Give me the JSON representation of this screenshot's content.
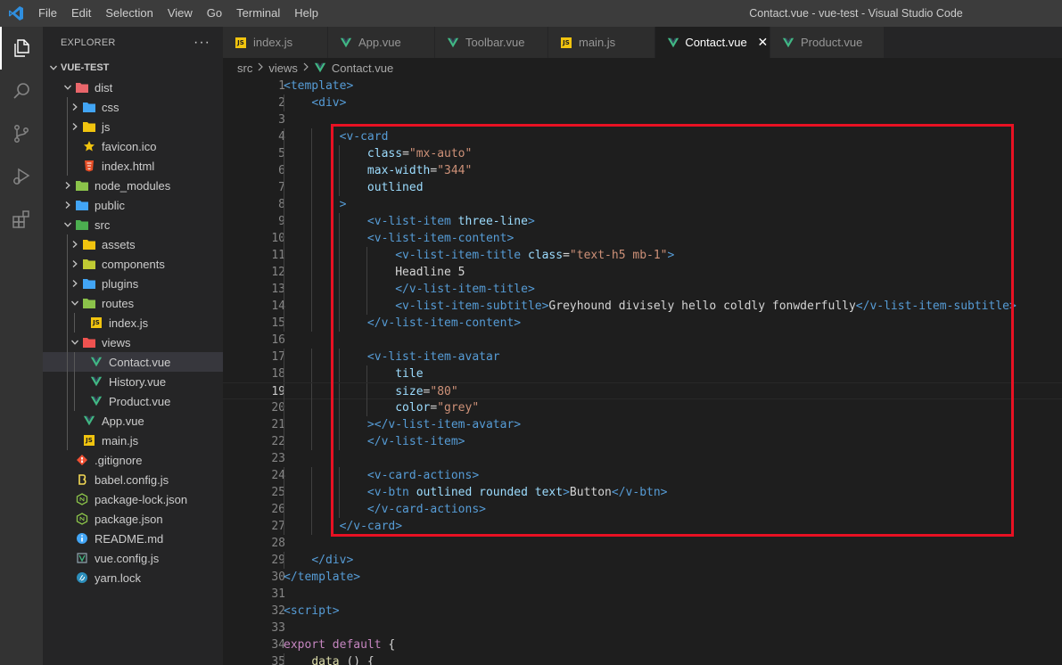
{
  "titlebar": {
    "menu": [
      "File",
      "Edit",
      "Selection",
      "View",
      "Go",
      "Terminal",
      "Help"
    ],
    "title": "Contact.vue - vue-test - Visual Studio Code"
  },
  "activity_bar": [
    "explorer-icon",
    "search-icon",
    "source-control-icon",
    "run-debug-icon",
    "extensions-icon"
  ],
  "explorer": {
    "header": "EXPLORER",
    "more": "···",
    "tree": [
      {
        "label": "VUE-TEST",
        "depth": 0,
        "kind": "root",
        "open": true
      },
      {
        "label": "dist",
        "depth": 1,
        "kind": "folder",
        "open": true,
        "color": "#e8676b"
      },
      {
        "label": "css",
        "depth": 2,
        "kind": "folder",
        "open": false,
        "color": "#42a5f5"
      },
      {
        "label": "js",
        "depth": 2,
        "kind": "folder",
        "open": false,
        "color": "#f1c40f"
      },
      {
        "label": "favicon.ico",
        "depth": 2,
        "kind": "star"
      },
      {
        "label": "index.html",
        "depth": 2,
        "kind": "html"
      },
      {
        "label": "node_modules",
        "depth": 1,
        "kind": "folder",
        "open": false,
        "color": "#8bc34a"
      },
      {
        "label": "public",
        "depth": 1,
        "kind": "folder",
        "open": false,
        "color": "#42a5f5"
      },
      {
        "label": "src",
        "depth": 1,
        "kind": "folder",
        "open": true,
        "color": "#4caf50"
      },
      {
        "label": "assets",
        "depth": 2,
        "kind": "folder",
        "open": false,
        "color": "#f1c40f"
      },
      {
        "label": "components",
        "depth": 2,
        "kind": "folder",
        "open": false,
        "color": "#c0ca33"
      },
      {
        "label": "plugins",
        "depth": 2,
        "kind": "folder",
        "open": false,
        "color": "#42a5f5"
      },
      {
        "label": "routes",
        "depth": 2,
        "kind": "folder",
        "open": true,
        "color": "#8bc34a"
      },
      {
        "label": "index.js",
        "depth": 3,
        "kind": "js"
      },
      {
        "label": "views",
        "depth": 2,
        "kind": "folder",
        "open": true,
        "color": "#ef5350"
      },
      {
        "label": "Contact.vue",
        "depth": 3,
        "kind": "vue",
        "selected": true
      },
      {
        "label": "History.vue",
        "depth": 3,
        "kind": "vue"
      },
      {
        "label": "Product.vue",
        "depth": 3,
        "kind": "vue"
      },
      {
        "label": "App.vue",
        "depth": 2,
        "kind": "vue"
      },
      {
        "label": "main.js",
        "depth": 2,
        "kind": "js"
      },
      {
        "label": ".gitignore",
        "depth": 1,
        "kind": "git"
      },
      {
        "label": "babel.config.js",
        "depth": 1,
        "kind": "babel"
      },
      {
        "label": "package-lock.json",
        "depth": 1,
        "kind": "npm"
      },
      {
        "label": "package.json",
        "depth": 1,
        "kind": "npm"
      },
      {
        "label": "README.md",
        "depth": 1,
        "kind": "info"
      },
      {
        "label": "vue.config.js",
        "depth": 1,
        "kind": "vuecfg"
      },
      {
        "label": "yarn.lock",
        "depth": 1,
        "kind": "yarn"
      }
    ]
  },
  "tabs": [
    {
      "label": "index.js",
      "kind": "js",
      "width": 118
    },
    {
      "label": "App.vue",
      "kind": "vue",
      "width": 120
    },
    {
      "label": "Toolbar.vue",
      "kind": "vue",
      "width": 127
    },
    {
      "label": "main.js",
      "kind": "js",
      "width": 120
    },
    {
      "label": "Contact.vue",
      "kind": "vue",
      "active": true,
      "close": "✕",
      "width": 129
    },
    {
      "label": "Product.vue",
      "kind": "vue",
      "width": 128
    }
  ],
  "breadcrumb": [
    "src",
    "views",
    "Contact.vue"
  ],
  "editor": {
    "current_line": 19,
    "lines": [
      [
        [
          "t-tag",
          "<template>"
        ]
      ],
      [
        [
          "t-pl",
          "    "
        ],
        [
          "t-tag",
          "<div>"
        ]
      ],
      [],
      [
        [
          "t-pl",
          "        "
        ],
        [
          "t-tag",
          "<v-card"
        ]
      ],
      [
        [
          "t-pl",
          "            "
        ],
        [
          "t-attr",
          "class"
        ],
        [
          "t-pl",
          "="
        ],
        [
          "t-str",
          "\"mx-auto\""
        ]
      ],
      [
        [
          "t-pl",
          "            "
        ],
        [
          "t-attr",
          "max-width"
        ],
        [
          "t-pl",
          "="
        ],
        [
          "t-str",
          "\"344\""
        ]
      ],
      [
        [
          "t-pl",
          "            "
        ],
        [
          "t-attr",
          "outlined"
        ]
      ],
      [
        [
          "t-pl",
          "        "
        ],
        [
          "t-tag",
          ">"
        ]
      ],
      [
        [
          "t-pl",
          "            "
        ],
        [
          "t-tag",
          "<v-list-item"
        ],
        [
          "t-pl",
          " "
        ],
        [
          "t-attr",
          "three-line"
        ],
        [
          "t-tag",
          ">"
        ]
      ],
      [
        [
          "t-pl",
          "            "
        ],
        [
          "t-tag",
          "<v-list-item-content>"
        ]
      ],
      [
        [
          "t-pl",
          "                "
        ],
        [
          "t-tag",
          "<v-list-item-title"
        ],
        [
          "t-pl",
          " "
        ],
        [
          "t-attr",
          "class"
        ],
        [
          "t-pl",
          "="
        ],
        [
          "t-str",
          "\"text-h5 mb-1\""
        ],
        [
          "t-tag",
          ">"
        ]
      ],
      [
        [
          "t-pl",
          "                Headline 5"
        ]
      ],
      [
        [
          "t-pl",
          "                "
        ],
        [
          "t-tag",
          "</v-list-item-title>"
        ]
      ],
      [
        [
          "t-pl",
          "                "
        ],
        [
          "t-tag",
          "<v-list-item-subtitle>"
        ],
        [
          "t-pl",
          "Greyhound divisely hello coldly fonwderfully"
        ],
        [
          "t-tag",
          "</v-list-item-subtitle>"
        ]
      ],
      [
        [
          "t-pl",
          "            "
        ],
        [
          "t-tag",
          "</v-list-item-content>"
        ]
      ],
      [],
      [
        [
          "t-pl",
          "            "
        ],
        [
          "t-tag",
          "<v-list-item-avatar"
        ]
      ],
      [
        [
          "t-pl",
          "                "
        ],
        [
          "t-attr",
          "tile"
        ]
      ],
      [
        [
          "t-pl",
          "                "
        ],
        [
          "t-attr",
          "size"
        ],
        [
          "t-pl",
          "="
        ],
        [
          "t-str",
          "\"80\""
        ]
      ],
      [
        [
          "t-pl",
          "                "
        ],
        [
          "t-attr",
          "color"
        ],
        [
          "t-pl",
          "="
        ],
        [
          "t-str",
          "\"grey\""
        ]
      ],
      [
        [
          "t-pl",
          "            "
        ],
        [
          "t-tag",
          "></v-list-item-avatar>"
        ]
      ],
      [
        [
          "t-pl",
          "            "
        ],
        [
          "t-tag",
          "</v-list-item>"
        ]
      ],
      [],
      [
        [
          "t-pl",
          "            "
        ],
        [
          "t-tag",
          "<v-card-actions>"
        ]
      ],
      [
        [
          "t-pl",
          "            "
        ],
        [
          "t-tag",
          "<v-btn"
        ],
        [
          "t-pl",
          " "
        ],
        [
          "t-attr",
          "outlined rounded text"
        ],
        [
          "t-tag",
          ">"
        ],
        [
          "t-pl",
          "Button"
        ],
        [
          "t-tag",
          "</v-btn>"
        ]
      ],
      [
        [
          "t-pl",
          "            "
        ],
        [
          "t-tag",
          "</v-card-actions>"
        ]
      ],
      [
        [
          "t-pl",
          "        "
        ],
        [
          "t-tag",
          "</v-card>"
        ]
      ],
      [],
      [
        [
          "t-pl",
          "    "
        ],
        [
          "t-tag",
          "</div>"
        ]
      ],
      [
        [
          "t-tag",
          "</template>"
        ]
      ],
      [],
      [
        [
          "t-tag",
          "<script>"
        ]
      ],
      [],
      [
        [
          "t-kw",
          "export"
        ],
        [
          "t-pl",
          " "
        ],
        [
          "t-kw",
          "default"
        ],
        [
          "t-pl",
          " {"
        ]
      ],
      [
        [
          "t-pl",
          "    "
        ],
        [
          "t-fn",
          "data"
        ],
        [
          "t-pl",
          " () {"
        ]
      ]
    ]
  },
  "colors": {
    "vue": "#41b883",
    "js_badge": "#f1c40f",
    "highlight": "#e81123"
  }
}
